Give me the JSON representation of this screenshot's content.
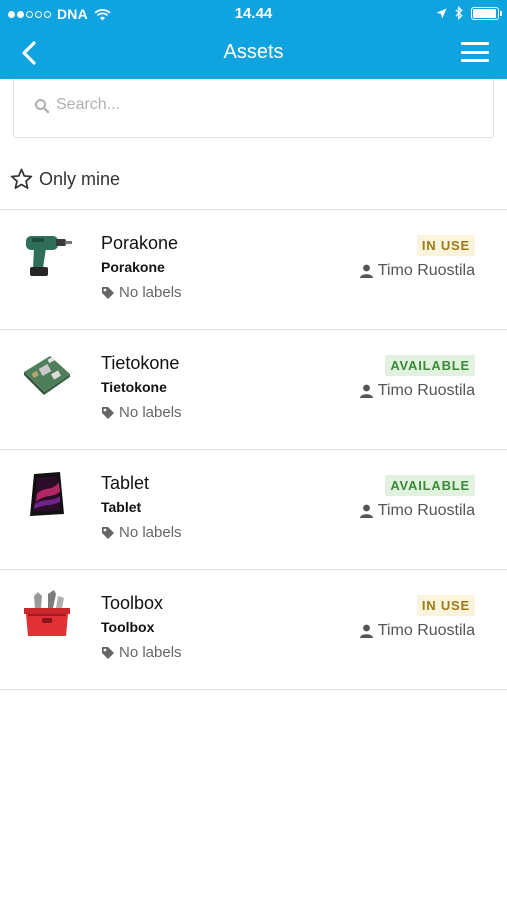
{
  "status_bar": {
    "carrier": "DNA",
    "time": "14.44",
    "signal_dots_filled": 2,
    "signal_dots_total": 5,
    "icons": [
      "wifi-icon",
      "location-arrow-icon",
      "bluetooth-icon",
      "battery-icon"
    ],
    "battery_level": 0.95
  },
  "header": {
    "title": "Assets",
    "back_icon": "chevron-left-icon",
    "menu_icon": "hamburger-menu-icon",
    "background": "#0fa3df"
  },
  "search": {
    "placeholder": "Search...",
    "value": ""
  },
  "filter": {
    "only_mine_label": "Only mine",
    "only_mine_checked": false
  },
  "assets": [
    {
      "name": "Porakone",
      "type": "Porakone",
      "labels": "No labels",
      "status": "IN USE",
      "owner": "Timo Ruostila",
      "thumbnail": "drill-image"
    },
    {
      "name": "Tietokone",
      "type": "Tietokone",
      "labels": "No labels",
      "status": "AVAILABLE",
      "owner": "Timo Ruostila",
      "thumbnail": "circuit-board-image"
    },
    {
      "name": "Tablet",
      "type": "Tablet",
      "labels": "No labels",
      "status": "AVAILABLE",
      "owner": "Timo Ruostila",
      "thumbnail": "tablet-image"
    },
    {
      "name": "Toolbox",
      "type": "Toolbox",
      "labels": "No labels",
      "status": "IN USE",
      "owner": "Timo Ruostila",
      "thumbnail": "toolbox-image"
    }
  ],
  "colors": {
    "in_use_bg": "#fbf4dd",
    "in_use_text": "#9b7a1c",
    "available_bg": "#e1f3df",
    "available_text": "#3e8a3c"
  }
}
